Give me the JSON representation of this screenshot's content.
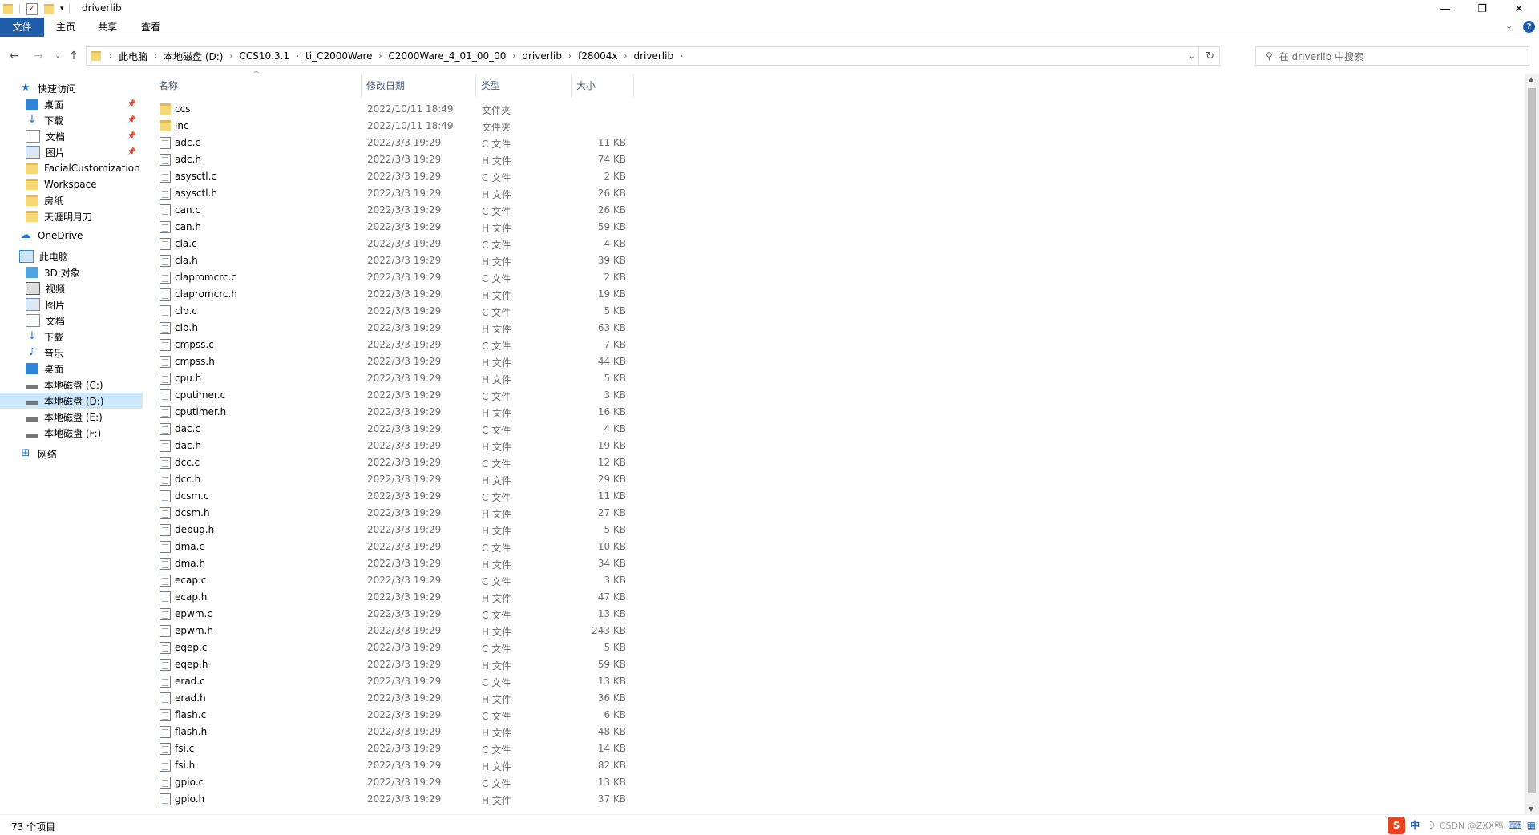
{
  "window": {
    "title": "driverlib",
    "minimize": "—",
    "maximize": "❐",
    "close": "✕"
  },
  "ribbon": {
    "tabs": [
      "文件",
      "主页",
      "共享",
      "查看"
    ]
  },
  "address": {
    "crumbs": [
      "此电脑",
      "本地磁盘 (D:)",
      "CCS10.3.1",
      "ti_C2000Ware",
      "C2000Ware_4_01_00_00",
      "driverlib",
      "f28004x",
      "driverlib"
    ]
  },
  "search": {
    "placeholder": "在 driverlib 中搜索"
  },
  "navpane": {
    "items": [
      {
        "label": "快速访问",
        "icon": "star-icon",
        "level": 0,
        "pinned": false
      },
      {
        "label": "桌面",
        "icon": "desktop-icon",
        "level": 1,
        "pinned": true
      },
      {
        "label": "下载",
        "icon": "download-icon",
        "level": 1,
        "pinned": true
      },
      {
        "label": "文档",
        "icon": "document-icon",
        "level": 1,
        "pinned": true
      },
      {
        "label": "图片",
        "icon": "picture-icon",
        "level": 1,
        "pinned": true
      },
      {
        "label": "FacialCustomization",
        "icon": "folder-icon",
        "level": 1,
        "pinned": false
      },
      {
        "label": "Workspace",
        "icon": "folder-icon",
        "level": 1,
        "pinned": false
      },
      {
        "label": "房纸",
        "icon": "folder-icon",
        "level": 1,
        "pinned": false
      },
      {
        "label": "天涯明月刀",
        "icon": "folder-icon",
        "level": 1,
        "pinned": false
      },
      {
        "label": "OneDrive",
        "icon": "cloud-icon",
        "level": 0,
        "pinned": false
      },
      {
        "label": "此电脑",
        "icon": "computer-icon",
        "level": 0,
        "pinned": false
      },
      {
        "label": "3D 对象",
        "icon": "cube-icon",
        "level": 1,
        "pinned": false
      },
      {
        "label": "视频",
        "icon": "video-icon",
        "level": 1,
        "pinned": false
      },
      {
        "label": "图片",
        "icon": "picture-icon",
        "level": 1,
        "pinned": false
      },
      {
        "label": "文档",
        "icon": "document-icon",
        "level": 1,
        "pinned": false
      },
      {
        "label": "下载",
        "icon": "download-icon",
        "level": 1,
        "pinned": false
      },
      {
        "label": "音乐",
        "icon": "music-icon",
        "level": 1,
        "pinned": false
      },
      {
        "label": "桌面",
        "icon": "desktop-icon",
        "level": 1,
        "pinned": false
      },
      {
        "label": "本地磁盘 (C:)",
        "icon": "drive-icon",
        "level": 1,
        "pinned": false
      },
      {
        "label": "本地磁盘 (D:)",
        "icon": "drive-icon",
        "level": 1,
        "pinned": false,
        "selected": true
      },
      {
        "label": "本地磁盘 (E:)",
        "icon": "drive-icon",
        "level": 1,
        "pinned": false
      },
      {
        "label": "本地磁盘 (F:)",
        "icon": "drive-icon",
        "level": 1,
        "pinned": false
      },
      {
        "label": "网络",
        "icon": "network-icon",
        "level": 0,
        "pinned": false
      }
    ]
  },
  "columns": {
    "name": "名称",
    "date": "修改日期",
    "type": "类型",
    "size": "大小"
  },
  "files": [
    {
      "name": "ccs",
      "date": "2022/10/11 18:49",
      "type": "文件夹",
      "size": "",
      "folder": true
    },
    {
      "name": "inc",
      "date": "2022/10/11 18:49",
      "type": "文件夹",
      "size": "",
      "folder": true
    },
    {
      "name": "adc.c",
      "date": "2022/3/3 19:29",
      "type": "C 文件",
      "size": "11 KB"
    },
    {
      "name": "adc.h",
      "date": "2022/3/3 19:29",
      "type": "H 文件",
      "size": "74 KB"
    },
    {
      "name": "asysctl.c",
      "date": "2022/3/3 19:29",
      "type": "C 文件",
      "size": "2 KB"
    },
    {
      "name": "asysctl.h",
      "date": "2022/3/3 19:29",
      "type": "H 文件",
      "size": "26 KB"
    },
    {
      "name": "can.c",
      "date": "2022/3/3 19:29",
      "type": "C 文件",
      "size": "26 KB"
    },
    {
      "name": "can.h",
      "date": "2022/3/3 19:29",
      "type": "H 文件",
      "size": "59 KB"
    },
    {
      "name": "cla.c",
      "date": "2022/3/3 19:29",
      "type": "C 文件",
      "size": "4 KB"
    },
    {
      "name": "cla.h",
      "date": "2022/3/3 19:29",
      "type": "H 文件",
      "size": "39 KB"
    },
    {
      "name": "clapromcrc.c",
      "date": "2022/3/3 19:29",
      "type": "C 文件",
      "size": "2 KB"
    },
    {
      "name": "clapromcrc.h",
      "date": "2022/3/3 19:29",
      "type": "H 文件",
      "size": "19 KB"
    },
    {
      "name": "clb.c",
      "date": "2022/3/3 19:29",
      "type": "C 文件",
      "size": "5 KB"
    },
    {
      "name": "clb.h",
      "date": "2022/3/3 19:29",
      "type": "H 文件",
      "size": "63 KB"
    },
    {
      "name": "cmpss.c",
      "date": "2022/3/3 19:29",
      "type": "C 文件",
      "size": "7 KB"
    },
    {
      "name": "cmpss.h",
      "date": "2022/3/3 19:29",
      "type": "H 文件",
      "size": "44 KB"
    },
    {
      "name": "cpu.h",
      "date": "2022/3/3 19:29",
      "type": "H 文件",
      "size": "5 KB"
    },
    {
      "name": "cputimer.c",
      "date": "2022/3/3 19:29",
      "type": "C 文件",
      "size": "3 KB"
    },
    {
      "name": "cputimer.h",
      "date": "2022/3/3 19:29",
      "type": "H 文件",
      "size": "16 KB"
    },
    {
      "name": "dac.c",
      "date": "2022/3/3 19:29",
      "type": "C 文件",
      "size": "4 KB"
    },
    {
      "name": "dac.h",
      "date": "2022/3/3 19:29",
      "type": "H 文件",
      "size": "19 KB"
    },
    {
      "name": "dcc.c",
      "date": "2022/3/3 19:29",
      "type": "C 文件",
      "size": "12 KB"
    },
    {
      "name": "dcc.h",
      "date": "2022/3/3 19:29",
      "type": "H 文件",
      "size": "29 KB"
    },
    {
      "name": "dcsm.c",
      "date": "2022/3/3 19:29",
      "type": "C 文件",
      "size": "11 KB"
    },
    {
      "name": "dcsm.h",
      "date": "2022/3/3 19:29",
      "type": "H 文件",
      "size": "27 KB"
    },
    {
      "name": "debug.h",
      "date": "2022/3/3 19:29",
      "type": "H 文件",
      "size": "5 KB"
    },
    {
      "name": "dma.c",
      "date": "2022/3/3 19:29",
      "type": "C 文件",
      "size": "10 KB"
    },
    {
      "name": "dma.h",
      "date": "2022/3/3 19:29",
      "type": "H 文件",
      "size": "34 KB"
    },
    {
      "name": "ecap.c",
      "date": "2022/3/3 19:29",
      "type": "C 文件",
      "size": "3 KB"
    },
    {
      "name": "ecap.h",
      "date": "2022/3/3 19:29",
      "type": "H 文件",
      "size": "47 KB"
    },
    {
      "name": "epwm.c",
      "date": "2022/3/3 19:29",
      "type": "C 文件",
      "size": "13 KB"
    },
    {
      "name": "epwm.h",
      "date": "2022/3/3 19:29",
      "type": "H 文件",
      "size": "243 KB"
    },
    {
      "name": "eqep.c",
      "date": "2022/3/3 19:29",
      "type": "C 文件",
      "size": "5 KB"
    },
    {
      "name": "eqep.h",
      "date": "2022/3/3 19:29",
      "type": "H 文件",
      "size": "59 KB"
    },
    {
      "name": "erad.c",
      "date": "2022/3/3 19:29",
      "type": "C 文件",
      "size": "13 KB"
    },
    {
      "name": "erad.h",
      "date": "2022/3/3 19:29",
      "type": "H 文件",
      "size": "36 KB"
    },
    {
      "name": "flash.c",
      "date": "2022/3/3 19:29",
      "type": "C 文件",
      "size": "6 KB"
    },
    {
      "name": "flash.h",
      "date": "2022/3/3 19:29",
      "type": "H 文件",
      "size": "48 KB"
    },
    {
      "name": "fsi.c",
      "date": "2022/3/3 19:29",
      "type": "C 文件",
      "size": "14 KB"
    },
    {
      "name": "fsi.h",
      "date": "2022/3/3 19:29",
      "type": "H 文件",
      "size": "82 KB"
    },
    {
      "name": "gpio.c",
      "date": "2022/3/3 19:29",
      "type": "C 文件",
      "size": "13 KB"
    },
    {
      "name": "gpio.h",
      "date": "2022/3/3 19:29",
      "type": "H 文件",
      "size": "37 KB"
    }
  ],
  "status": {
    "count": "73 个项目"
  },
  "tray": {
    "ime": "中",
    "watermark": "CSDN @ZXX鸭"
  },
  "colors": {
    "accent": "#1e5ba8",
    "selected": "#cce8ff",
    "sogou": "#e8431f"
  }
}
